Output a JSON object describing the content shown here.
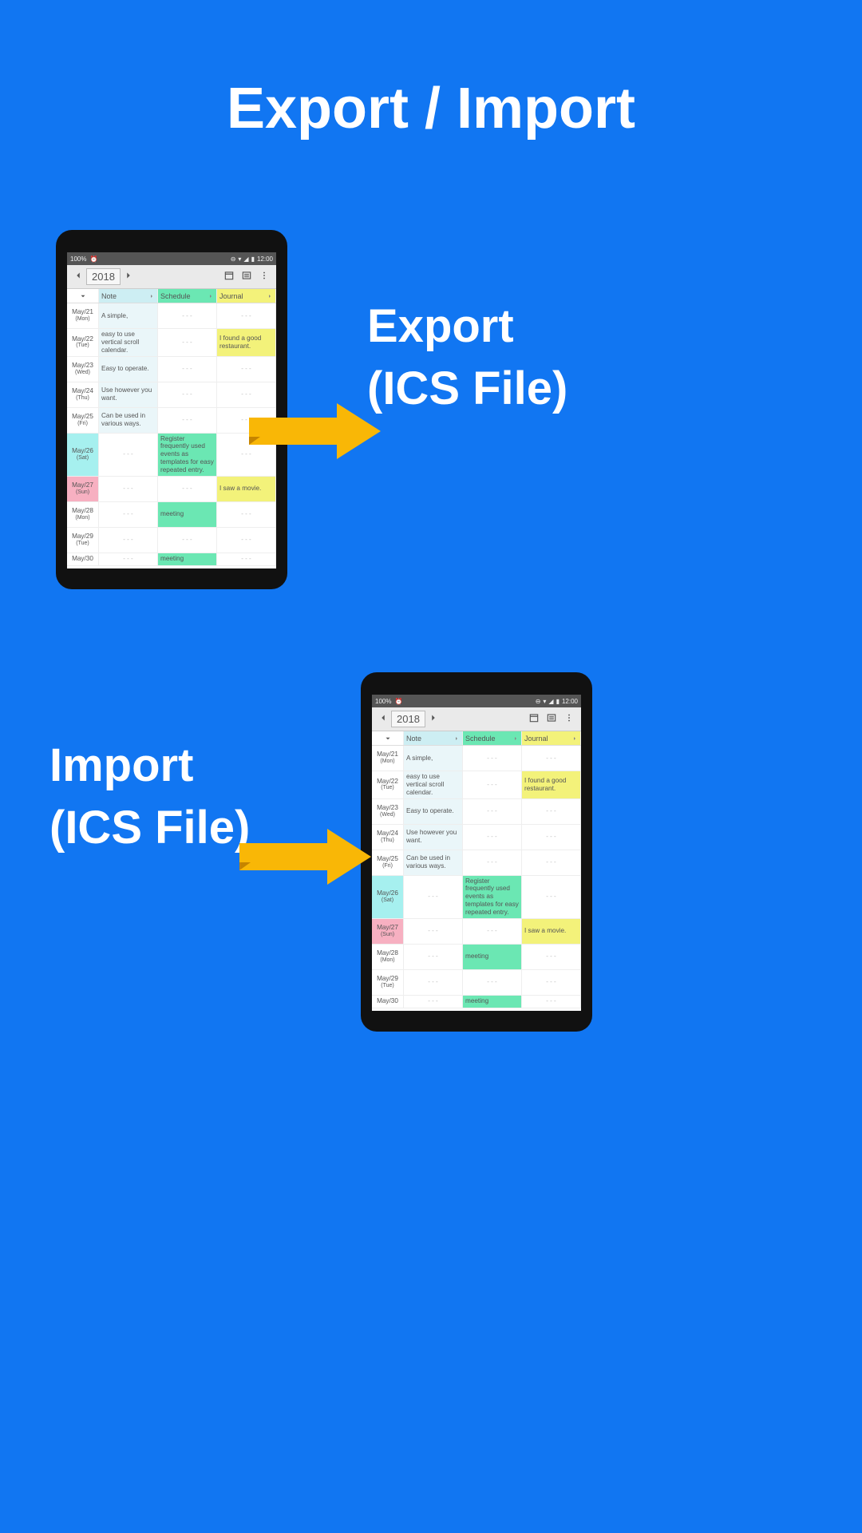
{
  "page": {
    "title": "Export / Import",
    "export_label": "Export\n(ICS File)",
    "import_label": "Import\n(ICS File)"
  },
  "statusbar": {
    "battery": "100%",
    "time": "12:00"
  },
  "toolbar": {
    "year": "2018"
  },
  "columns": {
    "note": "Note",
    "schedule": "Schedule",
    "journal": "Journal"
  },
  "rows": [
    {
      "date": "May/21",
      "dow": "(Mon)",
      "note": "A simple,",
      "schedule": "",
      "journal": ""
    },
    {
      "date": "May/22",
      "dow": "(Tue)",
      "note": "easy to use vertical scroll calendar.",
      "schedule": "",
      "journal": "I found a good restaurant."
    },
    {
      "date": "May/23",
      "dow": "(Wed)",
      "note": "Easy to operate.",
      "schedule": "",
      "journal": ""
    },
    {
      "date": "May/24",
      "dow": "(Thu)",
      "note": "Use however you want.",
      "schedule": "",
      "journal": ""
    },
    {
      "date": "May/25",
      "dow": "(Fri)",
      "note": "Can be used in various ways.",
      "schedule": "",
      "journal": ""
    },
    {
      "date": "May/26",
      "dow": "(Sat)",
      "note": "",
      "schedule": "Register frequently used events as templates for easy repeated entry.",
      "journal": ""
    },
    {
      "date": "May/27",
      "dow": "(Sun)",
      "note": "",
      "schedule": "",
      "journal": "I saw a movie."
    },
    {
      "date": "May/28",
      "dow": "(Mon)",
      "note": "",
      "schedule": "meeting",
      "journal": ""
    },
    {
      "date": "May/29",
      "dow": "(Tue)",
      "note": "",
      "schedule": "",
      "journal": ""
    },
    {
      "date": "May/30",
      "dow": "",
      "note": "",
      "schedule": "meeting",
      "journal": ""
    }
  ],
  "placeholder": "- - -"
}
